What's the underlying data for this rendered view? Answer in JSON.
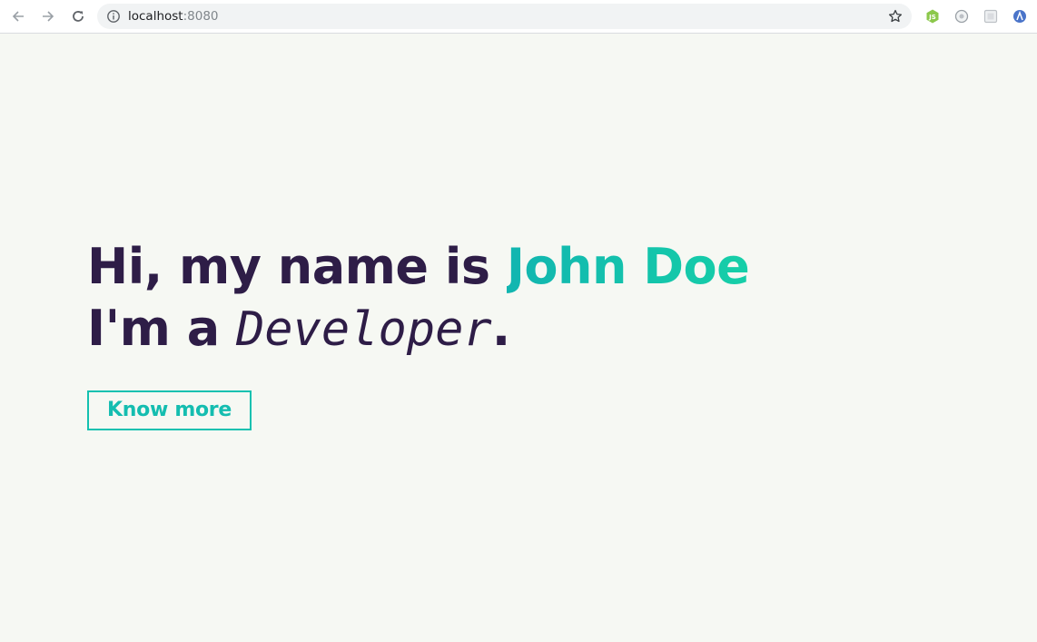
{
  "browser": {
    "url_host": "localhost",
    "url_port": ":8080",
    "icons": [
      "back-arrow-icon",
      "forward-arrow-icon",
      "reload-icon",
      "info-icon",
      "star-icon",
      "nodejs-extension-icon",
      "extension-icon",
      "extension-icon",
      "extension-icon"
    ]
  },
  "hero": {
    "greeting": "Hi, my name is ",
    "name": "John Doe",
    "role_prefix": "I'm a ",
    "role": "Developer",
    "role_suffix": ".",
    "cta_label": "Know more"
  },
  "colors": {
    "background": "#f6f8f3",
    "text_dark": "#2e1d47",
    "accent": "#14c1b0"
  }
}
